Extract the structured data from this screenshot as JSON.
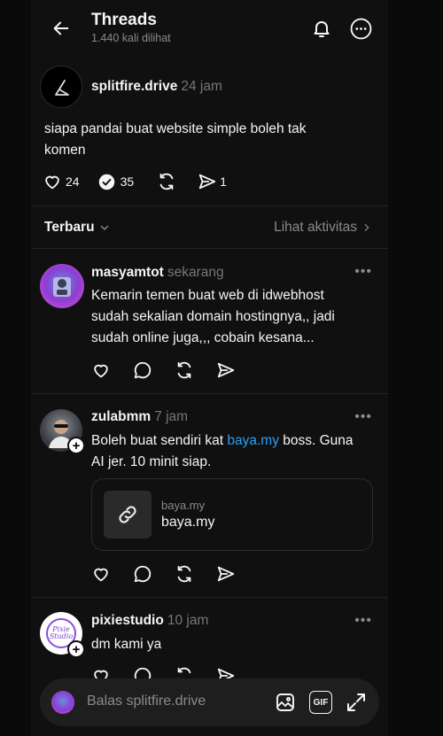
{
  "header": {
    "title": "Threads",
    "subtitle": "1.440 kali dilihat"
  },
  "post": {
    "username": "splitfire.drive",
    "time": "24 jam",
    "text_line1": "siapa pandai buat website simple boleh tak",
    "text_line2": "komen",
    "likes": "24",
    "replies": "35",
    "shares": "1"
  },
  "sort": {
    "label": "Terbaru",
    "activity_link": "Lihat aktivitas"
  },
  "comments": [
    {
      "username": "masyamtot",
      "time": "sekarang",
      "line1": "Kemarin temen buat web di idwebhost",
      "line2": "sudah sekalian domain hostingnya,, jadi",
      "line3": "sudah online juga,,, cobain kesana..."
    },
    {
      "username": "zulabmm",
      "time": "7 jam",
      "line1_pre": "Boleh buat sendiri kat ",
      "line1_link": "baya.my",
      "line1_post": " boss. Guna",
      "line2": "AI jer. 10 minit siap.",
      "card_small": "baya.my",
      "card_big": "baya.my"
    },
    {
      "username": "pixiestudio",
      "time": "10 jam",
      "line1": "dm kami ya",
      "avatar_text": "Pixie Studio"
    }
  ],
  "reply": {
    "placeholder": "Balas splitfire.drive",
    "gif_label": "GIF"
  },
  "colors": {
    "background": "#101010",
    "link": "#2aa0f5",
    "muted": "#8a8a8a"
  }
}
